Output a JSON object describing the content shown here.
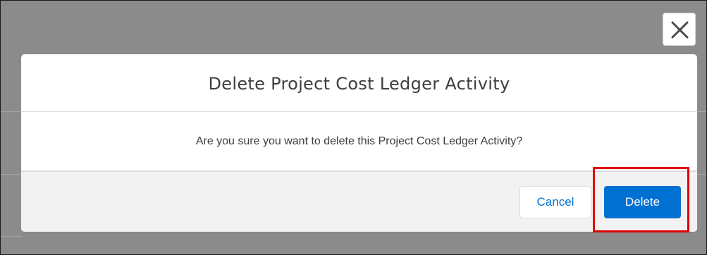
{
  "dialog": {
    "title": "Delete Project Cost Ledger Activity",
    "message": "Are you sure you want to delete this Project Cost Ledger Activity?",
    "cancel_label": "Cancel",
    "delete_label": "Delete",
    "close_icon": "close-icon"
  },
  "colors": {
    "overlay": "#8b8b8b",
    "brand_blue": "#0070d2",
    "highlight_red": "#e00000",
    "footer_bg": "#f3f2f2"
  }
}
